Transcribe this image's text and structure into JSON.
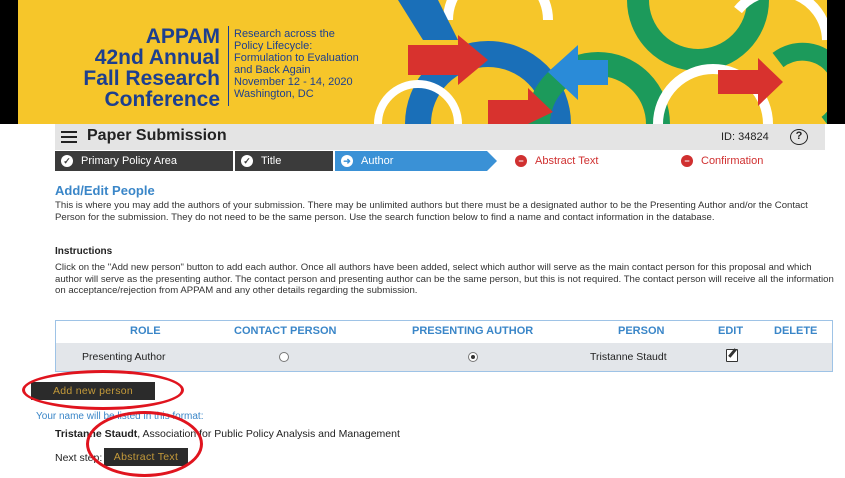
{
  "banner": {
    "org": "APPAM",
    "title_lines": [
      "42nd Annual",
      "Fall Research",
      "Conference"
    ],
    "subtitle_lines": [
      "Research across the",
      "Policy Lifecycle:",
      "Formulation to Evaluation",
      "and Back Again",
      "November 12 - 14, 2020",
      "Washington, DC"
    ]
  },
  "header": {
    "title": "Paper Submission",
    "submission_id": "ID: 34824",
    "help_glyph": "?"
  },
  "steps": [
    {
      "label": "Primary Policy Area",
      "status": "done"
    },
    {
      "label": "Title",
      "status": "done"
    },
    {
      "label": "Author",
      "status": "current"
    },
    {
      "label": "Abstract Text",
      "status": "todo"
    },
    {
      "label": "Confirmation",
      "status": "todo"
    }
  ],
  "content": {
    "section_title": "Add/Edit People",
    "intro": "This is where you may add the authors of your submission. There may be unlimited authors but there must be a designated author to be the Presenting Author and/or the Contact Person for the submission. They do not need to be the same person. Use the search function below to find a name and contact information in the database.",
    "instructions_heading": "Instructions",
    "instructions": "Click on the \"Add new person\" button to add each author. Once all authors have been added, select which author will serve as the main contact person for this proposal and which author will serve as the presenting author. The contact person and presenting author can be the same person, but this is not required. The contact person will receive all the information on acceptance/rejection from APPAM and any other details regarding the submission."
  },
  "table": {
    "headers": [
      "ROLE",
      "CONTACT PERSON",
      "PRESENTING AUTHOR",
      "PERSON",
      "EDIT",
      "DELETE"
    ],
    "rows": [
      {
        "role": "Presenting Author",
        "contact_person": false,
        "presenting_author": true,
        "person": "Tristanne Staudt"
      }
    ]
  },
  "actions": {
    "add_person_label": "Add new person",
    "listed_note": "Your name will be listed in this format:",
    "person_name": "Tristanne Staudt",
    "person_affiliation": ", Association for Public Policy Analysis and Management",
    "next_step_label": "Next step:",
    "next_button_label": "Abstract Text"
  },
  "colors": {
    "banner_yellow": "#f6c62a",
    "brand_blue": "#1d3f8f",
    "accent_blue": "#3a86c8",
    "step_dark": "#3b3b3b",
    "step_current": "#3a91d6",
    "step_todo": "#d03030",
    "button_text": "#c49a3a",
    "annotation_red": "#e0141e"
  }
}
